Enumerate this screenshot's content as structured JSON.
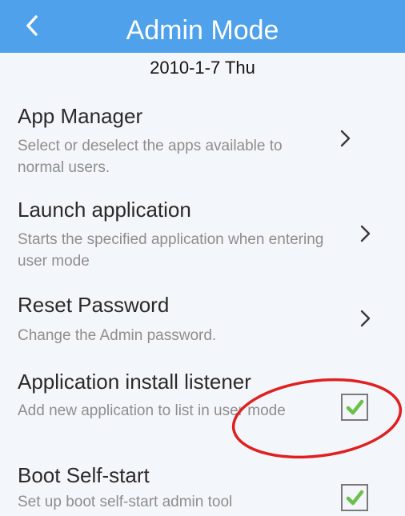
{
  "header": {
    "title": "Admin Mode",
    "back_icon": "chevron-left-icon",
    "background_color": "#4ea1ea"
  },
  "date": "2010-1-7 Thu",
  "items": [
    {
      "title": "App Manager",
      "subtitle": "Select or deselect the apps available to normal users.",
      "control": "chevron-right-icon"
    },
    {
      "title": "Launch application",
      "subtitle": "Starts the specified application when entering user mode",
      "control": "chevron-right-icon"
    },
    {
      "title": "Reset Password",
      "subtitle": "Change the Admin password.",
      "control": "chevron-right-icon"
    },
    {
      "title": "Application install listener",
      "subtitle": "Add new application to list in user mode",
      "control": "checkbox",
      "checked": true
    },
    {
      "title": "Boot Self-start",
      "subtitle": "Set up boot self-start admin tool",
      "control": "checkbox",
      "checked": true
    }
  ],
  "colors": {
    "check_mark": "#6cc04a",
    "annotation_circle": "#e02020"
  }
}
